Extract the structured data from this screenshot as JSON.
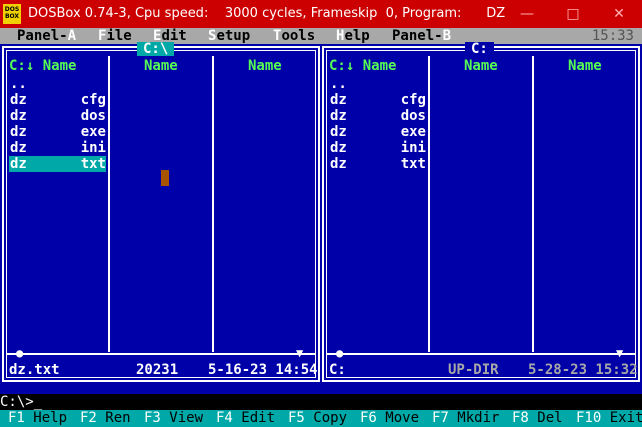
{
  "window": {
    "title": "DOSBox 0.74-3, Cpu speed:    3000 cycles, Frameskip  0, Program:      DZ",
    "icon_text": "DOS BOX",
    "minimize_icon": "minimize-icon",
    "maximize_icon": "maximize-icon",
    "close_icon": "close-icon"
  },
  "menu": {
    "items": [
      {
        "pre": "Panel-",
        "hk": "A",
        "post": ""
      },
      {
        "pre": "",
        "hk": "F",
        "post": "ile"
      },
      {
        "pre": "",
        "hk": "E",
        "post": "dit"
      },
      {
        "pre": "",
        "hk": "S",
        "post": "etup"
      },
      {
        "pre": "",
        "hk": "T",
        "post": "ools"
      },
      {
        "pre": "",
        "hk": "H",
        "post": "elp"
      },
      {
        "pre": "Panel-",
        "hk": "B",
        "post": ""
      }
    ],
    "clock": "15:33"
  },
  "panels": [
    {
      "label": "C:\\",
      "headers": [
        "C:↓ Name",
        "Name",
        "Name"
      ],
      "rows": [
        {
          "name": "..",
          "ext": ""
        },
        {
          "name": "dz",
          "ext": "cfg"
        },
        {
          "name": "dz",
          "ext": "dos"
        },
        {
          "name": "dz",
          "ext": "exe"
        },
        {
          "name": "dz",
          "ext": "ini"
        },
        {
          "name": "dz",
          "ext": "txt"
        }
      ],
      "selected_index": 5,
      "info_left": "dz.txt",
      "info_mid": "20231",
      "info_right": "5-16-23 14:54"
    },
    {
      "label": "C:",
      "headers": [
        "C:↓ Name",
        "Name",
        "Name"
      ],
      "rows": [
        {
          "name": "..",
          "ext": ""
        },
        {
          "name": "dz",
          "ext": "cfg"
        },
        {
          "name": "dz",
          "ext": "dos"
        },
        {
          "name": "dz",
          "ext": "exe"
        },
        {
          "name": "dz",
          "ext": "ini"
        },
        {
          "name": "dz",
          "ext": "txt"
        }
      ],
      "selected_index": -1,
      "info_left": "C:",
      "info_mid": "UP-DIR",
      "info_right": "5-28-23 15:32"
    }
  ],
  "command_line": "C:\\>_",
  "fkeys": [
    {
      "num": "F1",
      "label": " Help"
    },
    {
      "num": "F2",
      "label": " Ren"
    },
    {
      "num": "F3",
      "label": " View"
    },
    {
      "num": "F4",
      "label": " Edit"
    },
    {
      "num": "F5",
      "label": " Copy"
    },
    {
      "num": "F6",
      "label": " Move"
    },
    {
      "num": "F7",
      "label": " Mkdir"
    },
    {
      "num": "F8",
      "label": " Del"
    },
    {
      "num": "F10",
      "label": " Exit"
    }
  ],
  "colors": {
    "titlebar": "#cc0000",
    "panel_bg": "#0000a8",
    "selection": "#00a8a8",
    "header": "#54fc54"
  }
}
